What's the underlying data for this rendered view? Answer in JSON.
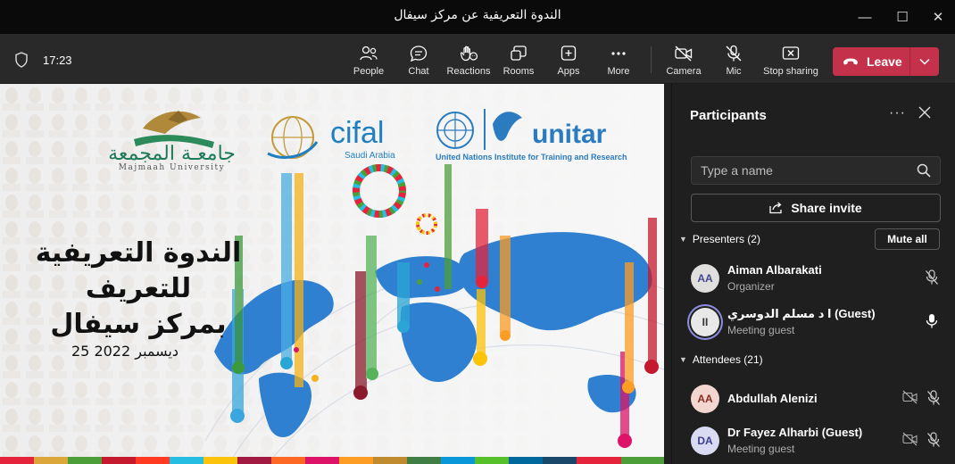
{
  "window": {
    "title": "الندوة التعريفية عن مركز سيفال",
    "minimize_glyph": "—",
    "maximize_glyph": "☐",
    "close_glyph": "✕"
  },
  "toolbar": {
    "time": "17:23",
    "buttons": [
      {
        "label": "People",
        "icon": "people-icon"
      },
      {
        "label": "Chat",
        "icon": "chat-icon"
      },
      {
        "label": "Reactions",
        "icon": "reactions-icon"
      },
      {
        "label": "Rooms",
        "icon": "rooms-icon"
      },
      {
        "label": "Apps",
        "icon": "apps-icon"
      },
      {
        "label": "More",
        "icon": "more-icon"
      },
      {
        "label": "Camera",
        "icon": "camera-off-icon"
      },
      {
        "label": "Mic",
        "icon": "mic-off-icon"
      },
      {
        "label": "Stop sharing",
        "icon": "stop-sharing-icon"
      }
    ],
    "leave_label": "Leave"
  },
  "slide": {
    "university_ar": "جامعـة المجمعة",
    "university_en": "Majmaah University",
    "cifal": "cifal",
    "cifal_sub": "Saudi Arabia",
    "unitar": "unitar",
    "unitar_sub": "United Nations Institute for Training and Research",
    "title_line1": "الندوة التعريفية للتعريف",
    "title_line2": "بمركز سيفال",
    "date": "25 ديسمبر 2022"
  },
  "panel": {
    "title": "Participants",
    "more_glyph": "···",
    "search_placeholder": "Type a name",
    "share_invite": "Share invite",
    "presenters_label": "Presenters (2)",
    "mute_all": "Mute all",
    "attendees_label": "Attendees (21)",
    "presenters": [
      {
        "initials": "AA",
        "name": "Aiman Albarakati",
        "role": "Organizer",
        "avatar_bg": "#e1dfdd",
        "avatar_fg": "#444791"
      },
      {
        "initials": "II",
        "name": "ا د مسلم الدوسري (Guest)",
        "role": "Meeting guest",
        "avatar_bg": "#e8e8e8",
        "avatar_fg": "#333333"
      }
    ],
    "attendees": [
      {
        "initials": "AA",
        "name": "Abdullah Alenizi",
        "role": "",
        "avatar_bg": "#f4d6d0",
        "avatar_fg": "#8a2b1f"
      },
      {
        "initials": "DA",
        "name": "Dr Fayez Alharbi (Guest)",
        "role": "Meeting guest",
        "avatar_bg": "#d9dbf2",
        "avatar_fg": "#3a3f8f"
      }
    ]
  },
  "colors": {
    "leave": "#c4314b",
    "panel_bg": "#1f1f1f",
    "toolbar_bg": "#292929",
    "titlebar_bg": "#0a0a0a"
  }
}
